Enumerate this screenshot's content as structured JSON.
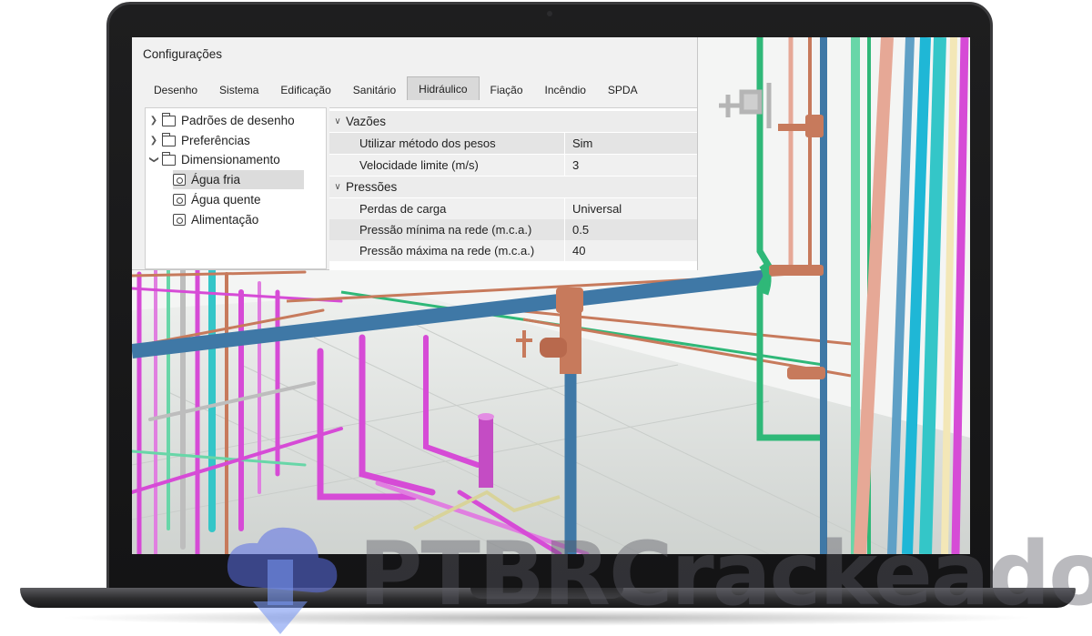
{
  "dialog": {
    "title": "Configurações",
    "tabs": [
      {
        "label": "Desenho"
      },
      {
        "label": "Sistema"
      },
      {
        "label": "Edificação"
      },
      {
        "label": "Sanitário"
      },
      {
        "label": "Hidráulico"
      },
      {
        "label": "Fiação"
      },
      {
        "label": "Incêndio"
      },
      {
        "label": "SPDA"
      }
    ],
    "active_tab": "Hidráulico",
    "tree": [
      {
        "label": "Padrões de desenho",
        "icon": "folder-icon",
        "expanded": false
      },
      {
        "label": "Preferências",
        "icon": "folder-icon",
        "expanded": false
      },
      {
        "label": "Dimensionamento",
        "icon": "folder-open-icon",
        "expanded": true
      },
      {
        "label": "Água fria",
        "icon": "settings-doc-icon",
        "selected": true
      },
      {
        "label": "Água quente",
        "icon": "settings-doc-icon"
      },
      {
        "label": "Alimentação",
        "icon": "settings-doc-icon"
      }
    ],
    "properties": {
      "vazoes": {
        "label": "Vazões",
        "rows": [
          {
            "name": "Utilizar método dos pesos",
            "value": "Sim"
          },
          {
            "name": "Velocidade limite (m/s)",
            "value": "3"
          }
        ]
      },
      "pressoes": {
        "label": "Pressões",
        "rows": [
          {
            "name": "Perdas de carga",
            "value": "Universal"
          },
          {
            "name": "Pressão mínima na rede (m.c.a.)",
            "value": "0.5"
          },
          {
            "name": "Pressão máxima na rede (m.c.a.)",
            "value": "40"
          }
        ]
      }
    }
  },
  "watermark": {
    "text": "PTBRCrackeado",
    "icon": "download-arrow-icon"
  },
  "colors": {
    "water_blue": "#3f78a6",
    "copper": "#c77a5c",
    "green": "#2fb878",
    "magenta": "#d64bd6",
    "teal": "#34c6c8",
    "cyan": "#1fb7d6",
    "mint": "#68d6a8",
    "laptop_frame": "#1a1a1b"
  }
}
